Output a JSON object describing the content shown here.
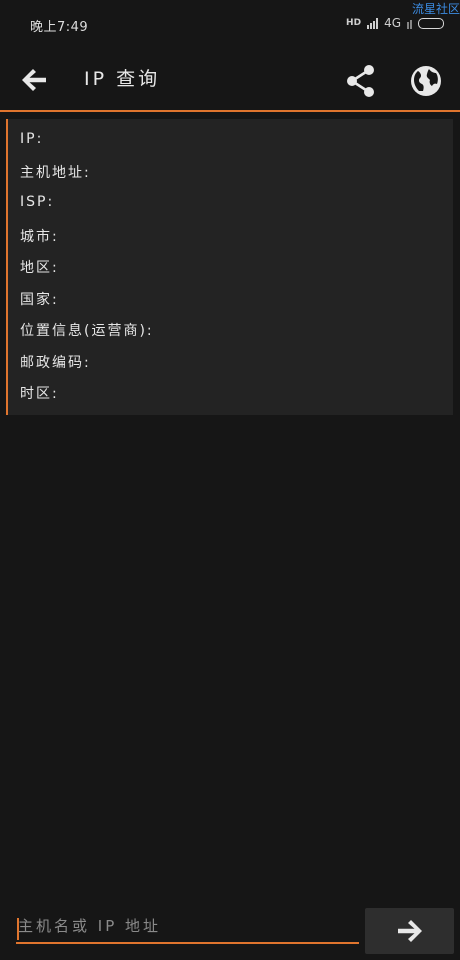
{
  "status_bar": {
    "time": "晚上7:49",
    "hd_label": "HD",
    "network_label": "4G"
  },
  "watermark": "流星社区",
  "app_bar": {
    "title": "IP 查询"
  },
  "result_fields": [
    {
      "label": "IP:"
    },
    {
      "label": "主机地址:"
    },
    {
      "label": "ISP:"
    },
    {
      "label": "城市:"
    },
    {
      "label": "地区:"
    },
    {
      "label": "国家:"
    },
    {
      "label": "位置信息(运营商):"
    },
    {
      "label": "邮政编码:"
    },
    {
      "label": "时区:"
    }
  ],
  "search": {
    "placeholder": "主机名或 IP 地址",
    "value": ""
  },
  "colors": {
    "accent": "#e0752e",
    "background": "#161616",
    "card": "#232323"
  },
  "icons": {
    "back": "arrow-left-icon",
    "share": "share-icon",
    "globe": "globe-icon",
    "go": "arrow-right-icon"
  }
}
